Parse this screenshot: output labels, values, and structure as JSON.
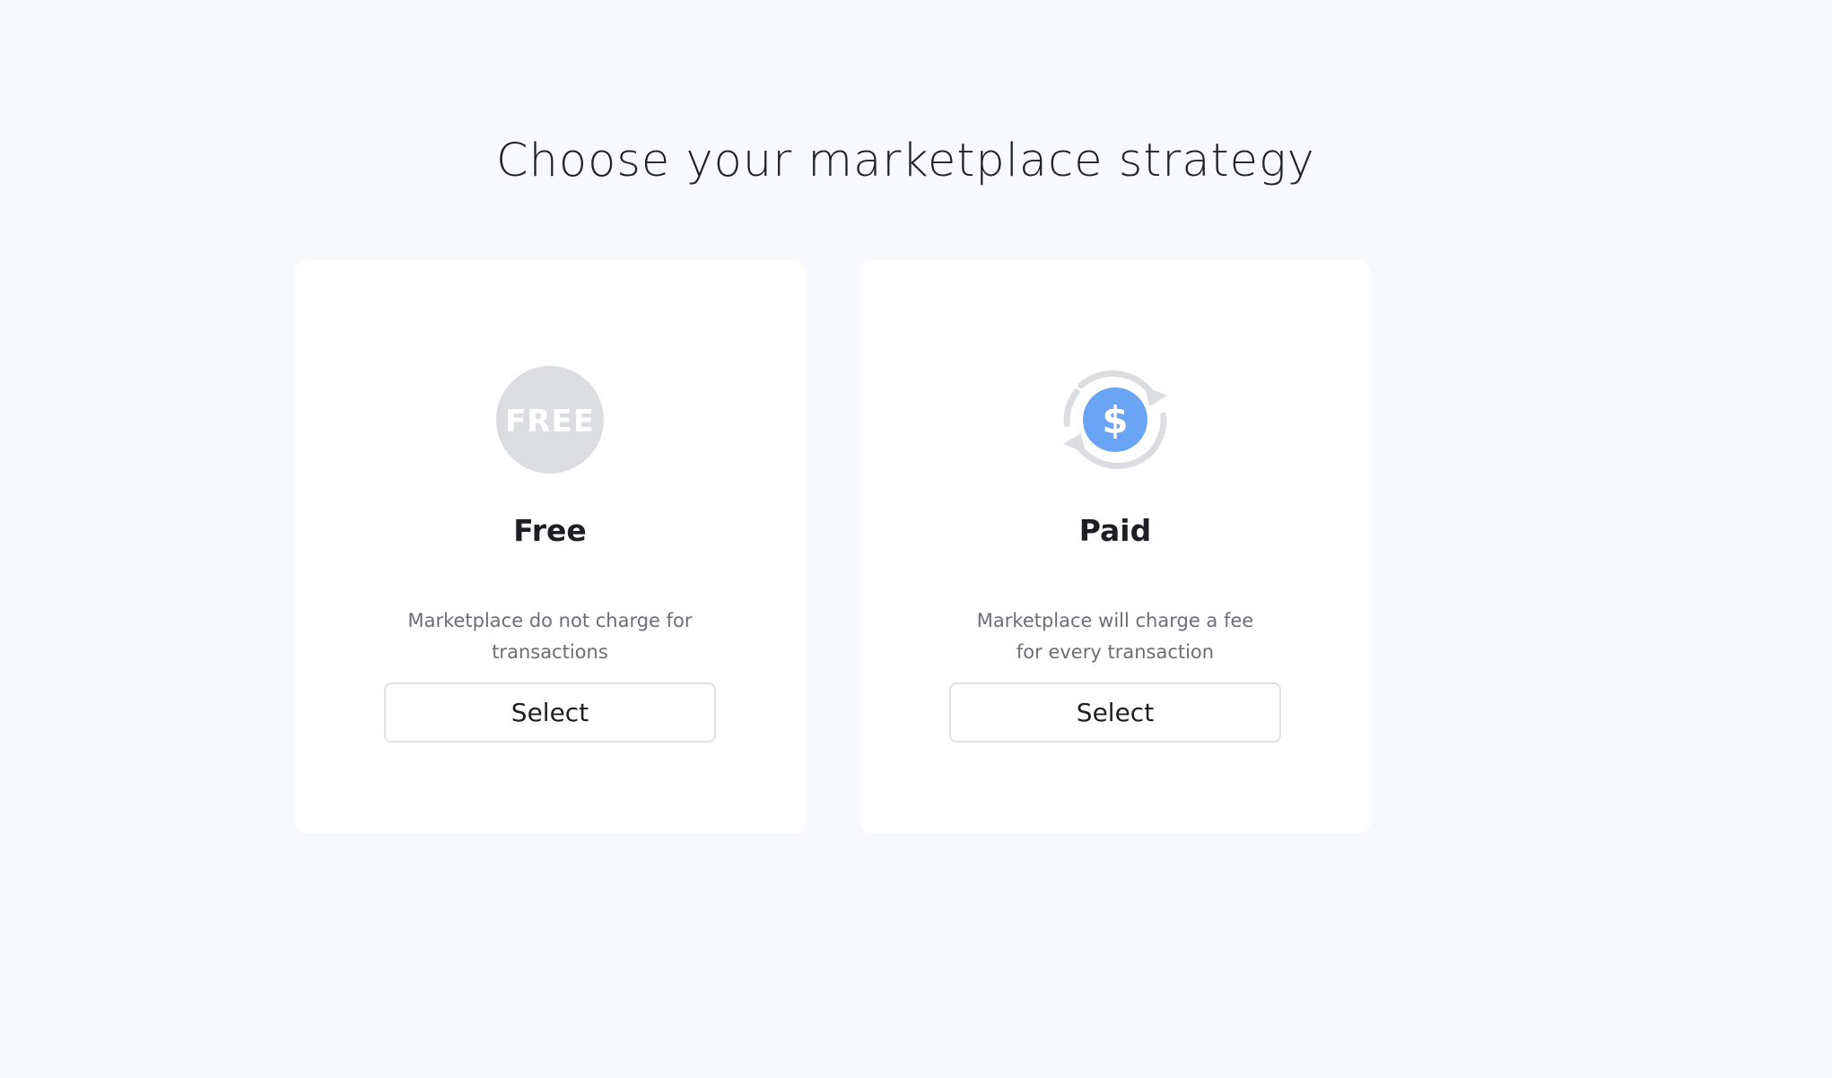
{
  "page": {
    "title": "Choose your marketplace strategy"
  },
  "options": [
    {
      "icon": "free-badge-icon",
      "icon_text": "FREE",
      "title": "Free",
      "description": "Marketplace do not charge for transactions",
      "button_label": "Select"
    },
    {
      "icon": "dollar-cycle-icon",
      "icon_text": "$",
      "title": "Paid",
      "description": "Marketplace will charge a fee for every transaction",
      "button_label": "Select"
    }
  ],
  "colors": {
    "background": "#f8f9fc",
    "card": "#ffffff",
    "free_badge": "#dcdde1",
    "dollar_accent": "#6aa4f4",
    "cycle_arrows": "#dcdde1",
    "button_border": "#dfe1e6",
    "title_text": "#1d1f24",
    "description_text": "#6b6e75"
  }
}
